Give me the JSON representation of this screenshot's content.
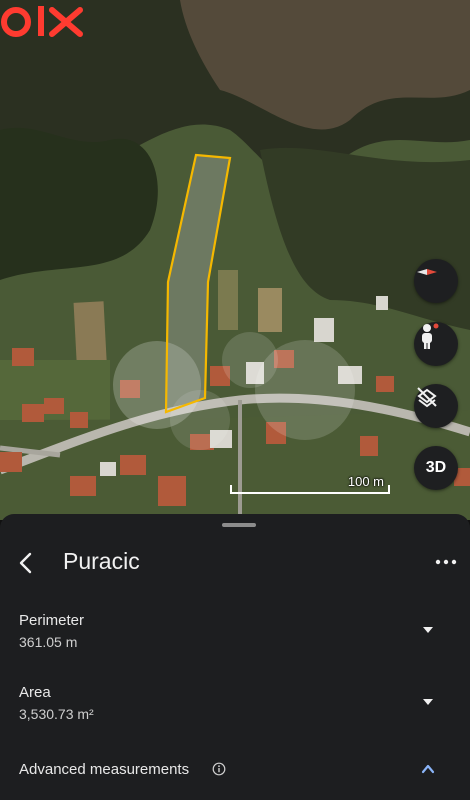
{
  "brand": {
    "logo_text": "OLX"
  },
  "map": {
    "scale_label": "100 m",
    "controls": {
      "three_d_label": "3D"
    },
    "outline_color": "#f5b800"
  },
  "sheet": {
    "title": "Puracic",
    "perimeter": {
      "label": "Perimeter",
      "value": "361.05 m"
    },
    "area": {
      "label": "Area",
      "value": "3,530.73 m²"
    },
    "advanced": {
      "label": "Advanced measurements"
    }
  },
  "colors": {
    "accent": "#8ab4f8",
    "sheet_bg": "#1d1e20",
    "logo": "#ff3b30"
  },
  "icons": [
    "back-icon",
    "more-vert-icon",
    "compass-icon",
    "pegman-icon",
    "layers-off-icon",
    "info-icon",
    "chevron-down-icon",
    "chevron-up-icon"
  ]
}
